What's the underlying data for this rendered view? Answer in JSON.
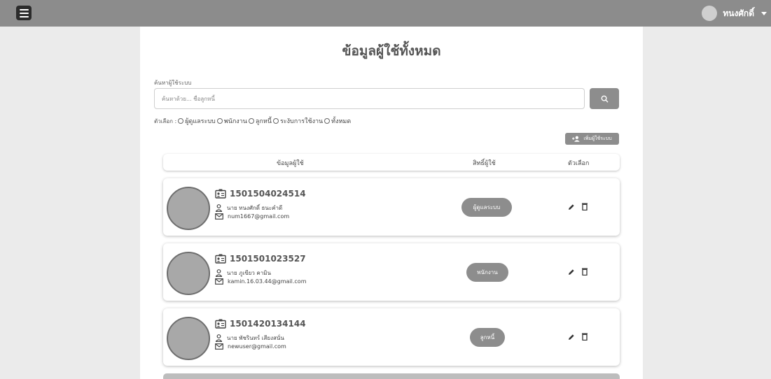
{
  "header": {
    "user_name": "ทนงศักดิ์"
  },
  "page": {
    "title": "ข้อมูลผู้ใช้ทั้งหมด",
    "search_label": "ค้นหาผู้ใช้ระบบ",
    "search_placeholder": "ค้นหาด้วย... ชื่อลูกหนี้",
    "filter_label": "ตัวเลือก :",
    "filters": [
      "ผู้ดูแลระบบ",
      "พนักงาน",
      "ลูกหนี้",
      "ระงับการใช้งาน",
      "ทั้งหมด"
    ],
    "add_user_label": "เพิ่มผู้ใช้ระบบ"
  },
  "table": {
    "columns": [
      "ข้อมูลผู้ใช้",
      "สิทธิ์ผู้ใช้",
      "ตัวเลือก"
    ],
    "rows": [
      {
        "id": "1501504024514",
        "name": "นาย ทนงศักดิ์ ธนะคำดี",
        "email": "num1667@gmail.com",
        "role": "ผู้ดูแลระบบ"
      },
      {
        "id": "1501501023527",
        "name": "นาย ภูเขียว คามิน",
        "email": "kamin.16.03.44@gmail.com",
        "role": "พนักงาน"
      },
      {
        "id": "1501420134144",
        "name": "นาย พัชรินทร์ เสียงสนั่น",
        "email": "newuser@gmail.com",
        "role": "ลูกหนี้"
      }
    ]
  },
  "colors": {
    "topbar": "#8c8c8c",
    "accent": "#8d8d8d",
    "background": "#ebebeb"
  },
  "icons": [
    "menu-icon",
    "search-icon",
    "add-user-icon",
    "id-card-icon",
    "person-icon",
    "mail-icon",
    "pencil-icon",
    "trash-icon"
  ]
}
